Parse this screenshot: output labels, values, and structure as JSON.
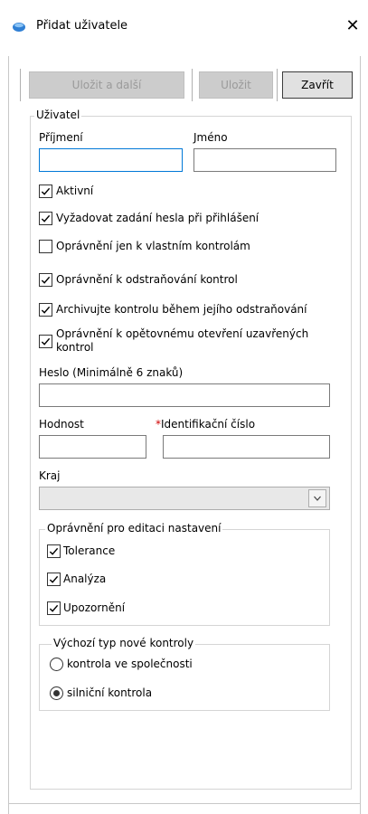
{
  "window": {
    "title": "Přidat uživatele",
    "close_glyph": "✕"
  },
  "toolbar": {
    "save_next_label": "Uložit a další",
    "save_label": "Uložit",
    "close_label": "Zavřít"
  },
  "user_group": {
    "legend": "Uživatel",
    "surname_label": "Příjmení",
    "surname_value": "",
    "name_label": "Jméno",
    "name_value": "",
    "checkboxes": [
      {
        "label": "Aktivní",
        "checked": true
      },
      {
        "label": "Vyžadovat zadání hesla při přihlášení",
        "checked": true
      },
      {
        "label": "Oprávnění jen k vlastním kontrolám",
        "checked": false
      },
      {
        "label": "Oprávnění k odstraňování kontrol",
        "checked": true
      },
      {
        "label": "Archivujte kontrolu během jejího odstraňování",
        "checked": true
      },
      {
        "label": "Oprávnění k opětovnému otevření uzavřených",
        "label2": "kontrol",
        "checked": true
      }
    ],
    "password_label": "Heslo (Minimálně 6 znaků)",
    "password_value": "",
    "rank_label": "Hodnost",
    "rank_value": "",
    "id_label": "Identifikační číslo",
    "id_required_mark": "*",
    "id_value": "",
    "region_label": "Kraj",
    "region_value": ""
  },
  "settings_group": {
    "legend": "Oprávnění pro editaci nastavení",
    "items": [
      {
        "label": "Tolerance",
        "checked": true
      },
      {
        "label": "Analýza",
        "checked": true
      },
      {
        "label": "Upozornění",
        "checked": true
      }
    ]
  },
  "default_type_group": {
    "legend": "Výchozí typ nové kontroly",
    "options": [
      {
        "label": "kontrola ve společnosti",
        "selected": false
      },
      {
        "label": "silniční kontrola",
        "selected": true
      }
    ]
  },
  "colors": {
    "focus": "#0078d7",
    "required": "#d00000",
    "app_icon": "#2f7fd4"
  }
}
